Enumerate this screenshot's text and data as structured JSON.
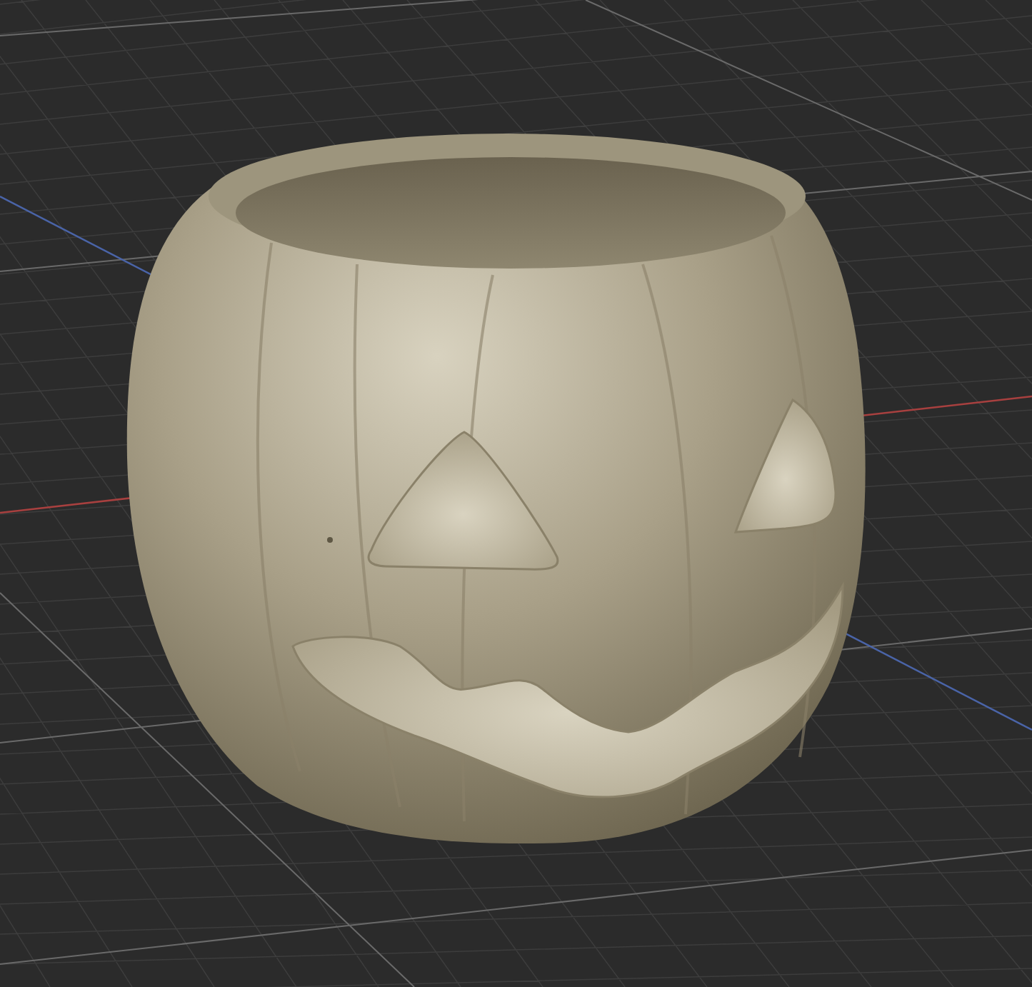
{
  "viewport": {
    "grid_visible": true,
    "axes": [
      {
        "kind": "x",
        "color": "#a8403f"
      },
      {
        "kind": "y",
        "color": "#4a64a8"
      }
    ]
  }
}
